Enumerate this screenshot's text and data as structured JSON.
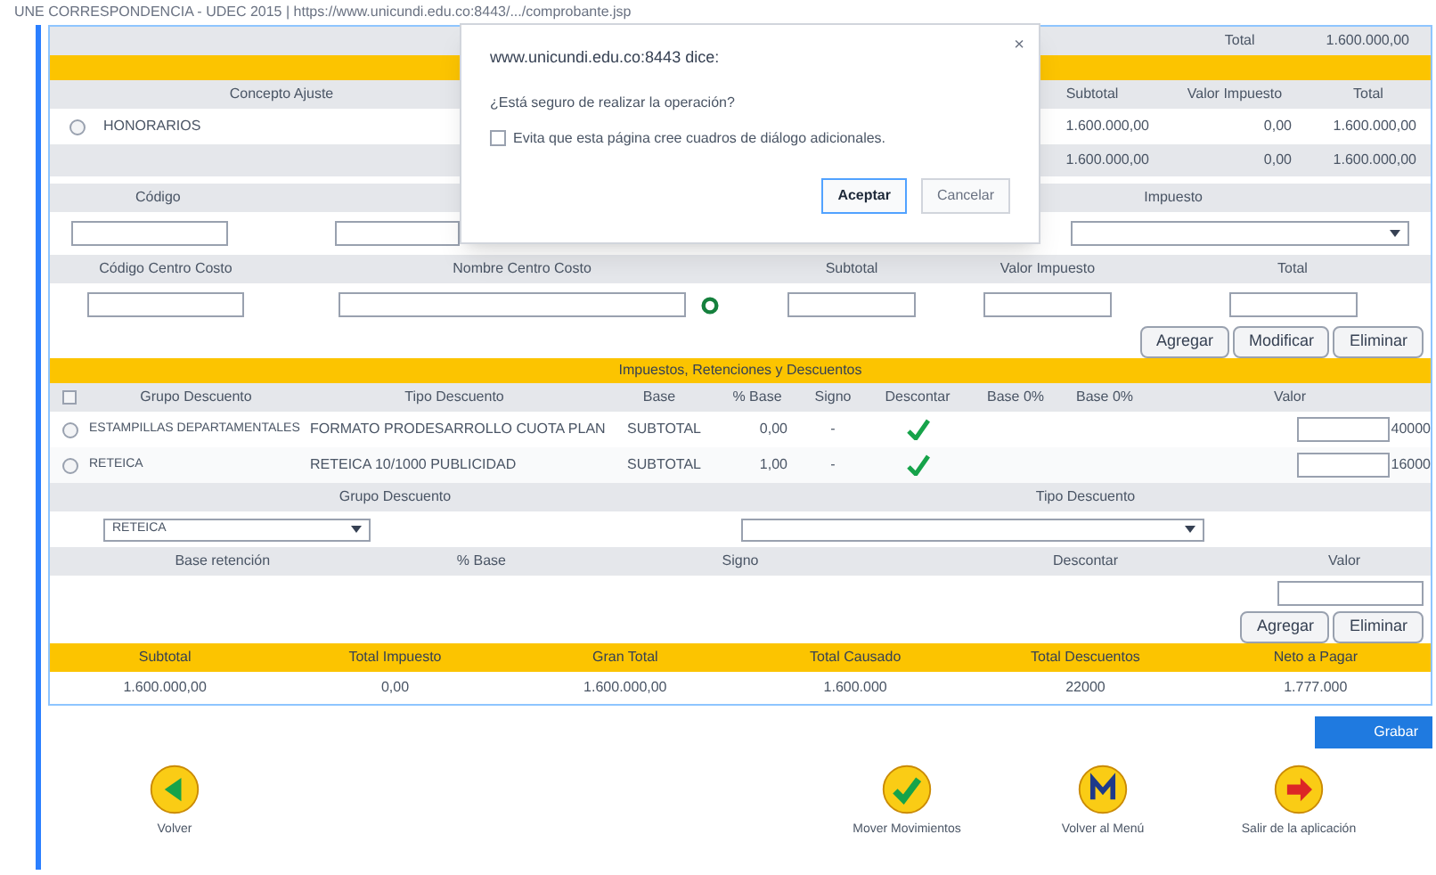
{
  "browser_title": "UNE CORRESPONDENCIA - UDEC 2015 | https://www.unicundi.edu.co:8443/.../comprobante.jsp",
  "top_total": {
    "label": "Total",
    "value": "1.600.000,00"
  },
  "concepts": {
    "columns": [
      "Concepto Ajuste",
      "Subtotal",
      "Valor Impuesto",
      "Total"
    ],
    "rows": [
      {
        "cells": [
          "HONORARIOS",
          "1.600.000,00",
          "0,00",
          "1.600.000,00"
        ],
        "selected": false
      }
    ],
    "totals": [
      "1.600.000,00",
      "0,00",
      "1.600.000,00"
    ]
  },
  "form1": {
    "labels": [
      "Código",
      "Impuesto"
    ]
  },
  "form2": {
    "labels": [
      "Código Centro Costo",
      "Nombre Centro Costo",
      "Subtotal",
      "Valor Impuesto",
      "Total"
    ]
  },
  "form_buttons": [
    "Agregar",
    "Modificar",
    "Eliminar"
  ],
  "taxes": {
    "title": "Impuestos, Retenciones y Descuentos",
    "all_checked": false,
    "columns": [
      "Grupo Descuento",
      "Tipo Descuento",
      "Base",
      "% Base",
      "Signo",
      "Descontar",
      "Base 0%",
      "Base 0%",
      "Valor"
    ],
    "rows": [
      {
        "group": "ESTAMPILLAS DEPARTAMENTALES",
        "type": "FORMATO PRODESARROLLO CUOTA PLAN",
        "base": "SUBTOTAL",
        "pct": "0,00",
        "sign": "-",
        "checked": true,
        "value": "40000",
        "selected": false
      },
      {
        "group": "RETEICA",
        "type": "RETEICA 10/1000 PUBLICIDAD",
        "base": "SUBTOTAL",
        "pct": "1,00",
        "sign": "-",
        "checked": true,
        "value": "16000",
        "selected": false
      }
    ]
  },
  "selectors": {
    "labels": [
      "Grupo Descuento",
      "Tipo Descuento"
    ],
    "group_value": "RETEICA"
  },
  "retention": {
    "columns": [
      "Base retención",
      "% Base",
      "Signo",
      "Descontar",
      "Valor"
    ]
  },
  "retention_buttons": [
    "Agregar",
    "Eliminar"
  ],
  "summary": {
    "columns": [
      "Subtotal",
      "Total Impuesto",
      "Gran Total",
      "Total Causado",
      "Total Descuentos",
      "Neto a Pagar"
    ],
    "values": [
      "1.600.000,00",
      "0,00",
      "1.600.000,00",
      "1.600.000",
      "22000",
      "1.777.000"
    ]
  },
  "save_button": "Grabar",
  "footer": [
    {
      "kind": "back",
      "label": "Volver"
    },
    {
      "kind": "move",
      "label": "Mover Movimientos"
    },
    {
      "kind": "menu",
      "label": "Volver al Menú"
    },
    {
      "kind": "exit",
      "label": "Salir de la aplicación"
    }
  ],
  "dialog": {
    "origin": "www.unicundi.edu.co:8443 dice:",
    "message": "¿Está seguro de realizar la operación?",
    "checkbox_label": "Evita que esta página cree cuadros de diálogo adicionales.",
    "checked": false,
    "close": "×",
    "buttons": [
      "Aceptar",
      "Cancelar"
    ]
  }
}
